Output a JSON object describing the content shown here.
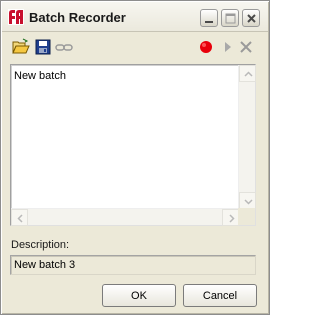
{
  "window": {
    "title": "Batch Recorder",
    "icon": "app-logo-icon"
  },
  "titlebar_buttons": {
    "minimize": "minimize-icon",
    "maximize": "maximize-icon",
    "close": "close-icon"
  },
  "toolbar": {
    "open": "folder-open-icon",
    "save": "floppy-disk-icon",
    "link": "chain-link-icon",
    "record": "record-icon",
    "play": "play-icon",
    "stop": "x-icon",
    "record_color": "#e8000b"
  },
  "editor": {
    "text": "New batch"
  },
  "description": {
    "label": "Description:",
    "value": "New batch 3"
  },
  "buttons": {
    "ok": "OK",
    "cancel": "Cancel"
  }
}
